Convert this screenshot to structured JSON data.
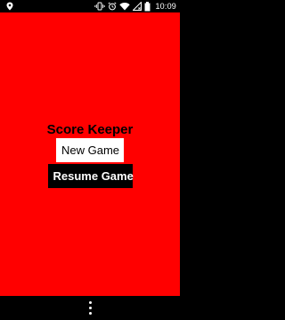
{
  "status_bar": {
    "time": "10:09",
    "icons": [
      "location-icon",
      "vibrate-icon",
      "alarm-icon",
      "wifi-icon",
      "signal-icon",
      "battery-icon"
    ]
  },
  "app": {
    "title": "Score Keeper",
    "new_game_label": "New Game",
    "resume_game_label": "Resume Game",
    "background_color": "#ff0000"
  },
  "nav_bar": {
    "icons": [
      "overflow-menu-icon"
    ]
  }
}
